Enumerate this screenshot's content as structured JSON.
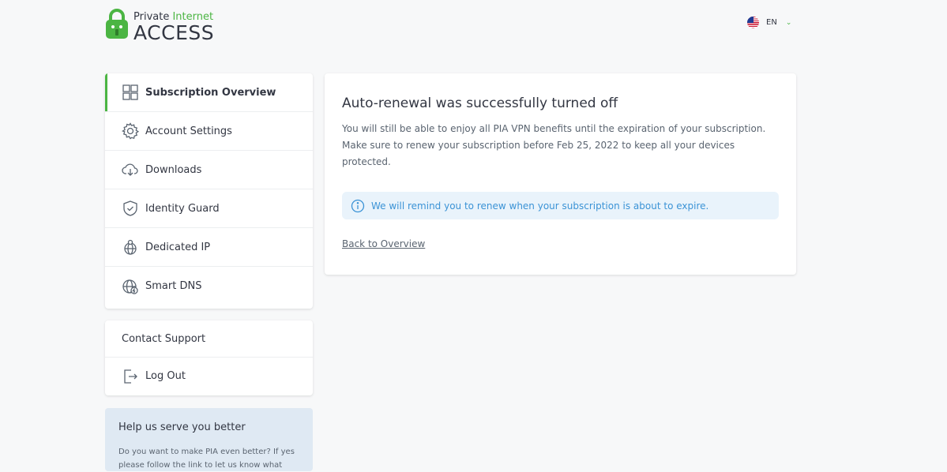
{
  "brand": {
    "line1_a": "Private",
    "line1_b": "Internet",
    "line2": "ACCESS",
    "accent": "#4bb543"
  },
  "language": {
    "code": "EN",
    "flag_icon": "us-flag-icon"
  },
  "sidebar": {
    "items": [
      {
        "label": "Subscription Overview",
        "icon": "grid-icon",
        "active": true
      },
      {
        "label": "Account Settings",
        "icon": "gear-icon"
      },
      {
        "label": "Downloads",
        "icon": "cloud-download-icon"
      },
      {
        "label": "Identity Guard",
        "icon": "shield-check-icon"
      },
      {
        "label": "Dedicated IP",
        "icon": "globe-pin-icon"
      },
      {
        "label": "Smart DNS",
        "icon": "globe-lightning-icon"
      }
    ]
  },
  "support": {
    "contact": "Contact Support",
    "logout": "Log Out"
  },
  "help": {
    "title": "Help us serve you better",
    "text": "Do you want to make PIA even better? If yes please follow the link to let us know what"
  },
  "main": {
    "title": "Auto-renewal was successfully turned off",
    "description": "You will still be able to enjoy all PIA VPN benefits until the expiration of your subscription. Make sure to renew your subscription before Feb 25, 2022 to keep all your devices protected.",
    "info": "We will remind you to renew when your subscription is about to expire.",
    "back_link": "Back to Overview",
    "info_color": "#3b93d6"
  }
}
